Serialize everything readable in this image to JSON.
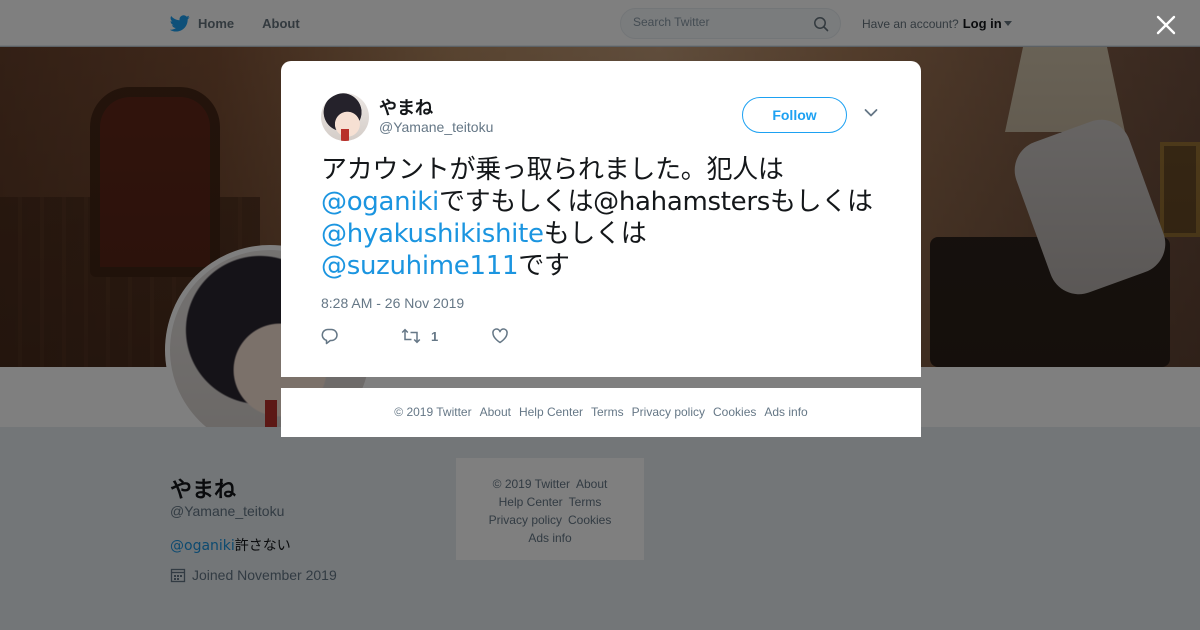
{
  "topbar": {
    "nav": [
      {
        "label": "Home",
        "icon": "twitter-bird-icon"
      },
      {
        "label": "About"
      }
    ],
    "search_placeholder": "Search Twitter",
    "account_prompt": "Have an account?",
    "login_label": "Log in"
  },
  "profile": {
    "name": "やまね",
    "handle": "@Yamane_teitoku",
    "bio_mention": "@oganiki",
    "bio_text": "許さない",
    "joined": "Joined November 2019"
  },
  "side_footer": {
    "links": [
      "© 2019 Twitter",
      "About",
      "Help Center",
      "Terms",
      "Privacy policy",
      "Cookies",
      "Ads info"
    ]
  },
  "tweet": {
    "author_name": "やまね",
    "author_handle": "@Yamane_teitoku",
    "follow_label": "Follow",
    "text_parts": [
      {
        "t": "アカウントが乗っ取られました。犯人は",
        "mention": false
      },
      {
        "t": "@oganiki",
        "mention": true
      },
      {
        "t": "ですもしくは@hahamstersもしくは",
        "mention": false
      },
      {
        "t": "@hyakushikishite",
        "mention": true
      },
      {
        "t": "もしくは",
        "mention": false
      },
      {
        "t": "@suzuhime111",
        "mention": true
      },
      {
        "t": "です",
        "mention": false
      }
    ],
    "timestamp": "8:28 AM - 26 Nov 2019",
    "retweet_count": "1"
  },
  "modal_footer": {
    "links": [
      "© 2019 Twitter",
      "About",
      "Help Center",
      "Terms",
      "Privacy policy",
      "Cookies",
      "Ads info"
    ]
  },
  "colors": {
    "accent": "#1da1f2",
    "mention": "#1b95e0",
    "secondary_text": "#657786"
  }
}
